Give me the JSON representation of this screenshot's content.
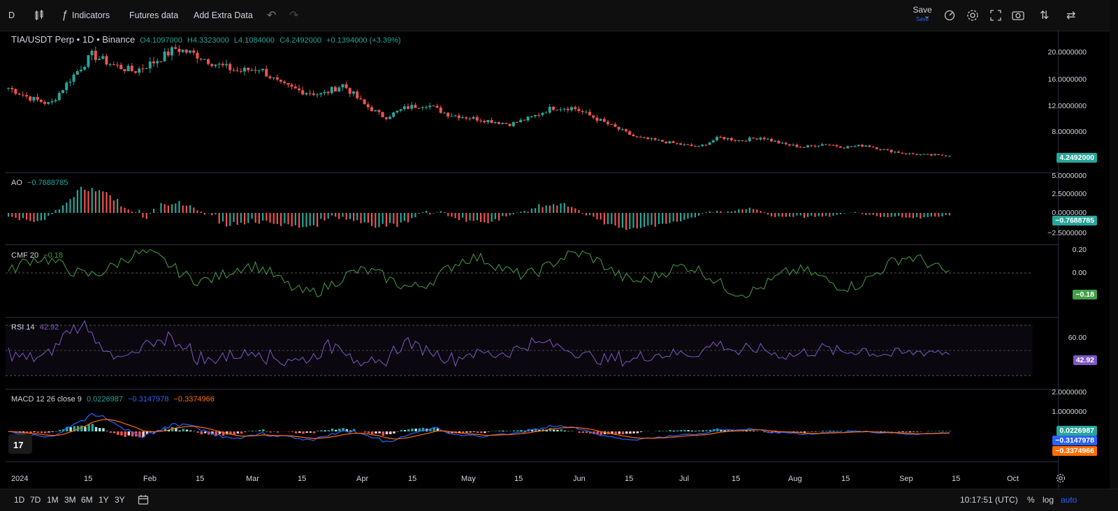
{
  "toolbar": {
    "interval": "D",
    "indicators_label": "Indicators",
    "futures_label": "Futures data",
    "extra_label": "Add Extra Data",
    "save_label": "Save",
    "save_sub": "Save"
  },
  "main": {
    "symbol": "TIA/USDT Perp • 1D • Binance",
    "open": "O4.1097000",
    "high": "H4.3323000",
    "low": "L4.1084000",
    "close": "C4.2492000",
    "change": "+0.1394000 (+3.39%)",
    "axis": [
      "20.0000000",
      "16.0000000",
      "12.0000000",
      "8.0000000"
    ],
    "price_tag": "4.2492000"
  },
  "ao": {
    "name": "AO",
    "value": "−0.7688785",
    "axis": [
      "5.0000000",
      "2.5000000",
      "0.0000000",
      "−2.5000000"
    ],
    "tag": "−0.7688785"
  },
  "cmf": {
    "name": "CMF 20",
    "value": "−0.18",
    "axis": [
      "0.20",
      "0.00"
    ],
    "tag": "−0.18"
  },
  "rsi": {
    "name": "RSI 14",
    "value": "42.92",
    "axis": [
      "60.00"
    ],
    "tag": "42.92"
  },
  "macd": {
    "name": "MACD 12 26 close 9",
    "v1": "0.0226987",
    "v2": "−0.3147978",
    "v3": "−0.3374966",
    "axis": [
      "2.0000000",
      "1.0000000"
    ],
    "tag1": "0.0226987",
    "tag2": "−0.3147978",
    "tag3": "−0.3374966"
  },
  "time_labels": [
    "2024",
    "15",
    "Feb",
    "15",
    "Mar",
    "15",
    "Apr",
    "15",
    "May",
    "15",
    "Jun",
    "15",
    "Jul",
    "15",
    "Aug",
    "15",
    "Sep",
    "15",
    "Oct"
  ],
  "bottom": {
    "ranges": [
      "1D",
      "7D",
      "1M",
      "3M",
      "6M",
      "1Y",
      "3Y"
    ],
    "clock": "10:17:51 (UTC)",
    "pct": "%",
    "log": "log",
    "auto": "auto"
  },
  "colors": {
    "up": "#26a69a",
    "down": "#ef5350",
    "cmf": "#43a047",
    "rsi": "#7e57c2",
    "macd": "#2962ff",
    "signal": "#ff6d00"
  },
  "chart_data": {
    "type": "candlestick",
    "price_series_approx": [
      14.5,
      13.0,
      12.0,
      16.0,
      19.5,
      18.0,
      17.0,
      18.5,
      20.5,
      19.5,
      18.0,
      17.0,
      17.5,
      15.0,
      14.0,
      13.5,
      15.0,
      12.0,
      10.0,
      11.5,
      12.0,
      10.5,
      10.0,
      9.5,
      9.0,
      10.0,
      11.5,
      11.5,
      10.0,
      8.5,
      7.0,
      6.5,
      6.0,
      5.5,
      7.0,
      6.5,
      7.0,
      6.0,
      5.5,
      6.0,
      5.5,
      5.8,
      5.0,
      4.5,
      4.3,
      4.25
    ]
  }
}
